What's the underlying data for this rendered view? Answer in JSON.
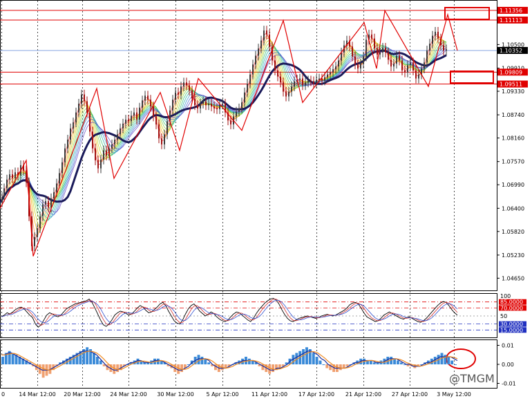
{
  "watermark": "@TMGM",
  "chart_data": [
    {
      "type": "line",
      "panel": "price",
      "title": "",
      "ylim": [
        1.0438,
        1.1158
      ],
      "price_ticks": [
        "1.10500",
        "1.09910",
        "1.09330",
        "1.08740",
        "1.08160",
        "1.07570",
        "1.06990",
        "1.06400",
        "1.05820",
        "1.05230",
        "1.04650"
      ],
      "price_tick_values": [
        1.105,
        1.0991,
        1.0933,
        1.0874,
        1.0816,
        1.0757,
        1.0699,
        1.064,
        1.0582,
        1.0523,
        1.0465
      ],
      "x_tick_labels": [
        "0",
        "14 Mar 12:00",
        "20 Mar 12:00",
        "24 Mar 12:00",
        "30 Mar 12:00",
        "5 Apr 12:00",
        "11 Apr 12:00",
        "17 Apr 12:00",
        "21 Apr 12:00",
        "27 Apr 12:00",
        "3 May 12:00"
      ],
      "horizontal_levels": [
        {
          "label": "1.11356",
          "value": 1.11356,
          "color": "#e00000",
          "style": "solid"
        },
        {
          "label": "1.11113",
          "value": 1.11113,
          "color": "#e00000",
          "style": "solid"
        },
        {
          "label": "1.10352",
          "value": 1.10352,
          "color": "#000000",
          "style": "current"
        },
        {
          "label": "1.09809",
          "value": 1.09809,
          "color": "#e00000",
          "style": "solid"
        },
        {
          "label": "1.09511",
          "value": 1.09511,
          "color": "#e00000",
          "style": "solid"
        }
      ],
      "blue_reference_level": 1.1035,
      "close_series": {
        "x": [
          0,
          3,
          6,
          10,
          14,
          18,
          22,
          26,
          30,
          34,
          38,
          42,
          46,
          50,
          54,
          58,
          62,
          66,
          70,
          74,
          78,
          82,
          86,
          90,
          94,
          98,
          102,
          106,
          110,
          114,
          118,
          122,
          126,
          130,
          134,
          138,
          142,
          146,
          150,
          154,
          158,
          162,
          166,
          170,
          174,
          178,
          182,
          186,
          190,
          194,
          198,
          202,
          206,
          210,
          214,
          218,
          222,
          226,
          230,
          234,
          238,
          242,
          246,
          250,
          254,
          258,
          262,
          266,
          270,
          274,
          278,
          282,
          286,
          290,
          294,
          298,
          302,
          306,
          310,
          314,
          318,
          322,
          326,
          330,
          334,
          338,
          342,
          346,
          350,
          354,
          358,
          362,
          366,
          370,
          374,
          378,
          382,
          386,
          390,
          394,
          398,
          402,
          406,
          410,
          414,
          418,
          422,
          426,
          430,
          434,
          438,
          442,
          446,
          450,
          454,
          458,
          462,
          466,
          470,
          474,
          478,
          482,
          486,
          490,
          494,
          498,
          502,
          506,
          510,
          514,
          518,
          522,
          526,
          530,
          534,
          538,
          542,
          546,
          550,
          554,
          558,
          562,
          566,
          570,
          574,
          578,
          582,
          586,
          590,
          594,
          598,
          602,
          606,
          610,
          614,
          618,
          622,
          626,
          630,
          634,
          638,
          642,
          646,
          650,
          654,
          658,
          662
        ],
        "y": [
          1.0655,
          1.0668,
          1.069,
          1.0712,
          1.0725,
          1.0715,
          1.073,
          1.0722,
          1.0748,
          1.0735,
          1.0705,
          1.062,
          1.0545,
          1.0568,
          1.059,
          1.062,
          1.065,
          1.0658,
          1.0642,
          1.0665,
          1.068,
          1.0702,
          1.0728,
          1.0755,
          1.079,
          1.0812,
          1.084,
          1.0855,
          1.088,
          1.0902,
          1.0925,
          1.0908,
          1.088,
          1.0832,
          1.079,
          1.076,
          1.074,
          1.0762,
          1.0785,
          1.0772,
          1.079,
          1.08,
          1.0812,
          1.0825,
          1.084,
          1.0852,
          1.0862,
          1.0858,
          1.0872,
          1.088,
          1.0862,
          1.0892,
          1.091,
          1.0922,
          1.0912,
          1.0895,
          1.087,
          1.085,
          1.0815,
          1.08,
          1.0825,
          1.0858,
          1.0885,
          1.0912,
          1.093,
          1.0925,
          1.0945,
          1.0955,
          1.0948,
          1.0935,
          1.0915,
          1.0898,
          1.089,
          1.0902,
          1.0908,
          1.0898,
          1.0902,
          1.0895,
          1.089,
          1.0888,
          1.09,
          1.0902,
          1.088,
          1.086,
          1.085,
          1.087,
          1.0882,
          1.089,
          1.0905,
          1.093,
          1.0952,
          1.0975,
          1.1,
          1.1022,
          1.104,
          1.106,
          1.1085,
          1.1075,
          1.1045,
          1.101,
          1.0985,
          1.097,
          1.0955,
          1.0932,
          1.092,
          1.0932,
          1.0945,
          1.0958,
          1.0962,
          1.0965,
          1.0948,
          1.0955,
          1.096,
          1.0958,
          1.0952,
          1.0962,
          1.0965,
          1.096,
          1.0968,
          1.0975,
          1.098,
          1.0988,
          1.0995,
          1.101,
          1.103,
          1.1048,
          1.106,
          1.1045,
          1.102,
          1.1,
          1.099,
          1.1002,
          1.102,
          1.1062,
          1.1075,
          1.1065,
          1.104,
          1.1025,
          1.103,
          1.1042,
          1.103,
          1.1012,
          1.0995,
          1.1002,
          1.1022,
          1.101,
          1.0985,
          1.098,
          1.0998,
          1.1005,
          1.0985,
          1.0965,
          1.0975,
          1.099,
          1.1005,
          1.1035,
          1.1052,
          1.1072,
          1.1082,
          1.1065,
          1.1048,
          1.1035,
          1.1038
        ]
      },
      "zigzag": {
        "x": [
          0,
          38,
          48,
          140,
          165,
          232,
          260,
          287,
          350,
          410,
          438,
          527,
          545,
          557,
          620,
          648,
          662
        ],
        "y": [
          1.064,
          1.076,
          1.052,
          1.094,
          1.0715,
          1.093,
          1.0785,
          1.0965,
          1.0835,
          1.111,
          1.0905,
          1.1105,
          1.099,
          1.1135,
          1.0945,
          1.1125,
          1.1035
        ]
      }
    },
    {
      "type": "line",
      "panel": "oscillator",
      "ylim": [
        0,
        100
      ],
      "tick_labels": [
        "100",
        "85.0000",
        "70.0000",
        "50",
        "30.0000",
        "15.0000"
      ],
      "tick_values": [
        100,
        85,
        70,
        50,
        30,
        15
      ],
      "series": [
        {
          "values": [
            48,
            52,
            58,
            55,
            60,
            66,
            70,
            72,
            68,
            60,
            52,
            46,
            30,
            22,
            28,
            40,
            52,
            58,
            55,
            50,
            48,
            52,
            60,
            68,
            72,
            76,
            80,
            82,
            84,
            86,
            88,
            92,
            84,
            70,
            55,
            40,
            28,
            24,
            30,
            40,
            52,
            58,
            62,
            60,
            56,
            52,
            55,
            62,
            70,
            76,
            72,
            64,
            58,
            60,
            66,
            72,
            80,
            84,
            76,
            62,
            50,
            38,
            32,
            30,
            40,
            55,
            68,
            76,
            80,
            72,
            62,
            56,
            50,
            54,
            60,
            56,
            48,
            42,
            38,
            36,
            40,
            48,
            55,
            60,
            58,
            52,
            46,
            40,
            36,
            44,
            56,
            66,
            74,
            82,
            88,
            92,
            94,
            90,
            80,
            66,
            54,
            44,
            38,
            36,
            40,
            44,
            46,
            48,
            50,
            48,
            46,
            44,
            46,
            50,
            52,
            54,
            52,
            50,
            52,
            56,
            60,
            64,
            70,
            78,
            82,
            84,
            80,
            70,
            58,
            48,
            44,
            40,
            36,
            38,
            44,
            52,
            56,
            60,
            56,
            52,
            48,
            44,
            42,
            46,
            48,
            44,
            40,
            36,
            34,
            38,
            44,
            52,
            60,
            68,
            76,
            82,
            86,
            84,
            76,
            66,
            58,
            52
          ]
        }
      ]
    },
    {
      "type": "bar",
      "panel": "macd",
      "ylim": [
        -0.012,
        0.012
      ],
      "tick_labels": [
        "0.01",
        "0.00",
        "-0.01"
      ],
      "tick_values": [
        0.01,
        0.0,
        -0.01
      ],
      "series": [
        {
          "values": [
            0.004,
            0.006,
            0.007,
            0.006,
            0.005,
            0.004,
            0.003,
            0.002,
            0.001,
            -0.001,
            -0.003,
            -0.005,
            -0.007,
            -0.006,
            -0.005,
            -0.003,
            -0.001,
            0.001,
            0.002,
            0.003,
            0.004,
            0.005,
            0.006,
            0.007,
            0.008,
            0.009,
            0.008,
            0.006,
            0.004,
            0.002,
            -0.001,
            -0.003,
            -0.004,
            -0.005,
            -0.004,
            -0.003,
            -0.001,
            0.0,
            0.001,
            0.002,
            0.003,
            0.002,
            0.001,
            0.001,
            0.002,
            0.003,
            0.003,
            0.002,
            0.001,
            -0.001,
            -0.002,
            -0.004,
            -0.005,
            -0.004,
            -0.002,
            0.0,
            0.002,
            0.004,
            0.005,
            0.004,
            0.003,
            0.001,
            -0.001,
            -0.003,
            -0.004,
            -0.003,
            -0.002,
            -0.001,
            0.0,
            0.001,
            0.002,
            0.003,
            0.004,
            0.003,
            0.002,
            0.001,
            -0.001,
            -0.003,
            -0.004,
            -0.005,
            -0.004,
            -0.003,
            -0.002,
            -0.001,
            0.001,
            0.003,
            0.005,
            0.006,
            0.007,
            0.008,
            0.009,
            0.008,
            0.006,
            0.004,
            0.002,
            0.0,
            -0.002,
            -0.003,
            -0.004,
            -0.004,
            -0.003,
            -0.002,
            -0.001,
            0.0,
            0.001,
            0.002,
            0.003,
            0.003,
            0.002,
            0.002,
            0.001,
            0.001,
            0.002,
            0.003,
            0.004,
            0.004,
            0.003,
            0.002,
            0.001,
            0.0,
            -0.001,
            -0.001,
            -0.002,
            -0.001,
            0.0,
            0.001,
            0.002,
            0.003,
            0.004,
            0.005,
            0.006,
            0.005,
            0.004,
            0.002,
            0.0
          ]
        },
        {
          "values": [
            0.005,
            0.005,
            0.006,
            0.006,
            0.005,
            0.004,
            0.003,
            0.002,
            0.001,
            0.0,
            -0.001,
            -0.002,
            -0.003,
            -0.003,
            -0.003,
            -0.002,
            -0.001,
            0.0,
            0.001,
            0.002,
            0.003,
            0.004,
            0.005,
            0.006,
            0.007,
            0.007,
            0.007,
            0.006,
            0.005,
            0.003,
            0.001,
            -0.001,
            -0.002,
            -0.003,
            -0.003,
            -0.002,
            -0.001,
            0.0,
            0.001,
            0.001,
            0.002,
            0.002,
            0.001,
            0.001,
            0.001,
            0.002,
            0.002,
            0.002,
            0.001,
            0.0,
            -0.001,
            -0.002,
            -0.003,
            -0.003,
            -0.002,
            -0.001,
            0.001,
            0.002,
            0.003,
            0.003,
            0.003,
            0.002,
            0.0,
            -0.001,
            -0.002,
            -0.002,
            -0.002,
            -0.001,
            0.0,
            0.001,
            0.001,
            0.002,
            0.002,
            0.002,
            0.002,
            0.001,
            0.0,
            -0.001,
            -0.002,
            -0.003,
            -0.003,
            -0.002,
            -0.002,
            -0.001,
            0.0,
            0.002,
            0.003,
            0.004,
            0.005,
            0.006,
            0.007,
            0.007,
            0.006,
            0.005,
            0.003,
            0.002,
            0.0,
            -0.001,
            -0.002,
            -0.002,
            -0.002,
            -0.002,
            -0.001,
            0.0,
            0.001,
            0.001,
            0.002,
            0.002,
            0.002,
            0.002,
            0.001,
            0.001,
            0.001,
            0.002,
            0.003,
            0.003,
            0.003,
            0.002,
            0.001,
            0.0,
            0.0,
            -0.001,
            -0.001,
            -0.001,
            0.0,
            0.001,
            0.001,
            0.002,
            0.003,
            0.004,
            0.004,
            0.004,
            0.004,
            0.003,
            0.002
          ]
        }
      ]
    }
  ]
}
